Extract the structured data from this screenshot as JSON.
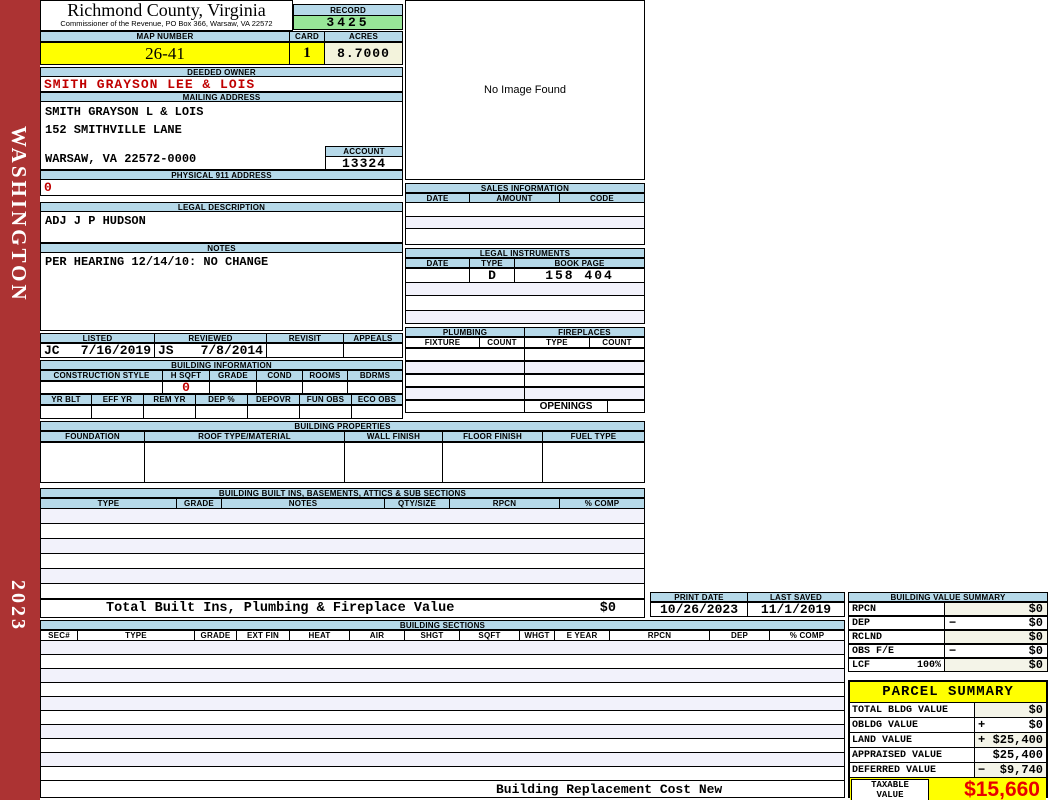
{
  "sidebar": {
    "county": "WASHINGTON",
    "year": "2023"
  },
  "header": {
    "county_title": "Richmond County, Virginia",
    "commissioner_line": "Commissioner of the Revenue, PO Box 366, Warsaw, VA 22572",
    "record_label": "RECORD",
    "record_value": "3425",
    "map_number_label": "MAP NUMBER",
    "map_number_value": "26-41",
    "card_label": "CARD",
    "card_value": "1",
    "acres_label": "ACRES",
    "acres_value": "8.7000"
  },
  "owner": {
    "deeded_owner_label": "DEEDED OWNER",
    "deeded_owner_value": "SMITH GRAYSON LEE & LOIS",
    "mailing_address_label": "MAILING ADDRESS",
    "mailing_line1": "SMITH GRAYSON L & LOIS",
    "mailing_line2": "152 SMITHVILLE LANE",
    "mailing_line3": "WARSAW, VA 22572-0000",
    "account_label": "ACCOUNT",
    "account_value": "13324",
    "physical_label": "PHYSICAL 911 ADDRESS",
    "physical_value": "0"
  },
  "legal": {
    "description_label": "LEGAL DESCRIPTION",
    "description_value": "ADJ J P HUDSON",
    "notes_label": "NOTES",
    "notes_value": "PER HEARING 12/14/10: NO CHANGE"
  },
  "review": {
    "cols": [
      "LISTED",
      "REVIEWED",
      "REVISIT",
      "APPEALS"
    ],
    "listed_by": "JC",
    "listed_date": "7/16/2019",
    "reviewed_by": "JS",
    "reviewed_date": "7/8/2014"
  },
  "building_information": {
    "title": "BUILDING INFORMATION",
    "cols1": [
      "CONSTRUCTION STYLE",
      "H SQFT",
      "GRADE",
      "COND",
      "ROOMS",
      "BDRMS"
    ],
    "h_sqft_value": "0",
    "cols2": [
      "YR BLT",
      "EFF YR",
      "REM YR",
      "DEP %",
      "DEPOVR",
      "FUN OBS",
      "ECO OBS"
    ]
  },
  "building_properties": {
    "title": "BUILDING PROPERTIES",
    "cols": [
      "FOUNDATION",
      "ROOF TYPE/MATERIAL",
      "WALL FINISH",
      "FLOOR FINISH",
      "FUEL TYPE"
    ]
  },
  "built_ins": {
    "title": "BUILDING BUILT INS, BASEMENTS, ATTICS & SUB SECTIONS",
    "cols": [
      "TYPE",
      "GRADE",
      "NOTES",
      "QTY/SIZE",
      "RPCN",
      "% COMP"
    ],
    "total_label": "Total Built Ins, Plumbing & Fireplace Value",
    "total_value": "$0"
  },
  "photo": {
    "placeholder": "No Image Found"
  },
  "sales": {
    "title": "SALES INFORMATION",
    "cols": [
      "DATE",
      "AMOUNT",
      "CODE"
    ]
  },
  "instruments": {
    "title": "LEGAL INSTRUMENTS",
    "cols": [
      "DATE",
      "TYPE",
      "BOOK PAGE"
    ],
    "row1": {
      "date": "",
      "type": "D",
      "book_page": "158 404"
    }
  },
  "plumbing": {
    "title": "PLUMBING",
    "cols": [
      "FIXTURE",
      "COUNT"
    ]
  },
  "fireplaces": {
    "title": "FIREPLACES",
    "cols": [
      "TYPE",
      "COUNT"
    ],
    "openings_label": "OPENINGS"
  },
  "print_info": {
    "print_date_label": "PRINT DATE",
    "print_date_value": "10/26/2023",
    "last_saved_label": "LAST SAVED",
    "last_saved_value": "11/1/2019"
  },
  "building_value_summary": {
    "title": "BUILDING VALUE SUMMARY",
    "rows": [
      {
        "label": "RPCN",
        "pct": "",
        "sign": "",
        "value": "$0"
      },
      {
        "label": "DEP",
        "pct": "",
        "sign": "−",
        "value": "$0"
      },
      {
        "label": "RCLND",
        "pct": "",
        "sign": "",
        "value": "$0"
      },
      {
        "label": "OBS F/E",
        "pct": "",
        "sign": "−",
        "value": "$0"
      },
      {
        "label": "LCF",
        "pct": "100%",
        "sign": "",
        "value": "$0"
      }
    ]
  },
  "building_sections": {
    "title": "BUILDING SECTIONS",
    "cols": [
      "SEC#",
      "TYPE",
      "GRADE",
      "EXT FIN",
      "HEAT",
      "AIR",
      "SHGT",
      "SQFT",
      "WHGT",
      "E YEAR",
      "RPCN",
      "DEP",
      "% COMP"
    ],
    "footer": "Building Replacement Cost New"
  },
  "parcel_summary": {
    "title": "PARCEL SUMMARY",
    "rows": [
      {
        "label": "TOTAL BLDG VALUE",
        "sign": "",
        "value": "$0"
      },
      {
        "label": "OBLDG VALUE",
        "sign": "+",
        "value": "$0"
      },
      {
        "label": "LAND VALUE",
        "sign": "+",
        "value": "$25,400"
      },
      {
        "label": "APPRAISED VALUE",
        "sign": "",
        "value": "$25,400"
      },
      {
        "label": "DEFERRED VALUE",
        "sign": "−",
        "value": "$9,740"
      }
    ],
    "taxable_label1": "TAXABLE",
    "taxable_label2": "VALUE",
    "taxable_value": "$15,660"
  }
}
